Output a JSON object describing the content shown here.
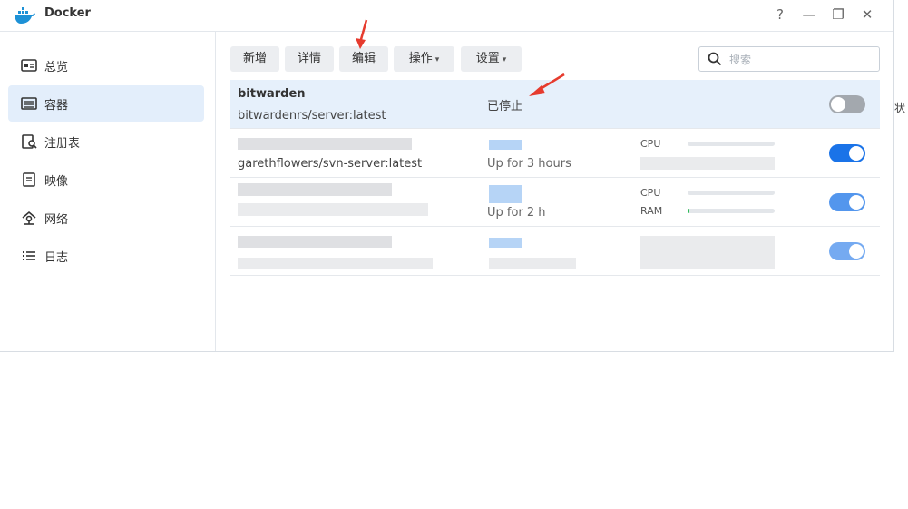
{
  "window": {
    "title": "Docker",
    "buttons": {
      "help": "?",
      "minimize": "—",
      "maximize": "❐",
      "close": "✕"
    }
  },
  "sidebar": {
    "items": [
      {
        "label": "总览",
        "icon": "overview-icon"
      },
      {
        "label": "容器",
        "icon": "container-icon"
      },
      {
        "label": "注册表",
        "icon": "registry-icon"
      },
      {
        "label": "映像",
        "icon": "image-icon"
      },
      {
        "label": "网络",
        "icon": "network-icon"
      },
      {
        "label": "日志",
        "icon": "log-icon"
      }
    ],
    "active_index": 1
  },
  "toolbar": {
    "new": "新增",
    "details": "详情",
    "edit": "编辑",
    "action": "操作",
    "settings": "设置",
    "search_placeholder": "搜索"
  },
  "containers": [
    {
      "name": "bitwarden",
      "image": "bitwardenrs/server:latest",
      "status": "已停止",
      "running": false
    },
    {
      "name": "",
      "image": "garethflowers/svn-server:latest",
      "status": "",
      "uptime": "Up for 3 hours",
      "running": true,
      "metric_labels": [
        "CPU"
      ]
    },
    {
      "name": "",
      "image": "",
      "status": "",
      "uptime": "Up for 2 h",
      "running": true,
      "metric_labels": [
        "CPU",
        "RAM"
      ]
    },
    {
      "name": "",
      "image": "",
      "status": "",
      "uptime": "",
      "running": true,
      "metric_labels": []
    }
  ],
  "edge_text": "状",
  "colors": {
    "accent": "#1a73e8",
    "selected_row": "#e6f0fb",
    "annotation": "#e63b2e"
  }
}
